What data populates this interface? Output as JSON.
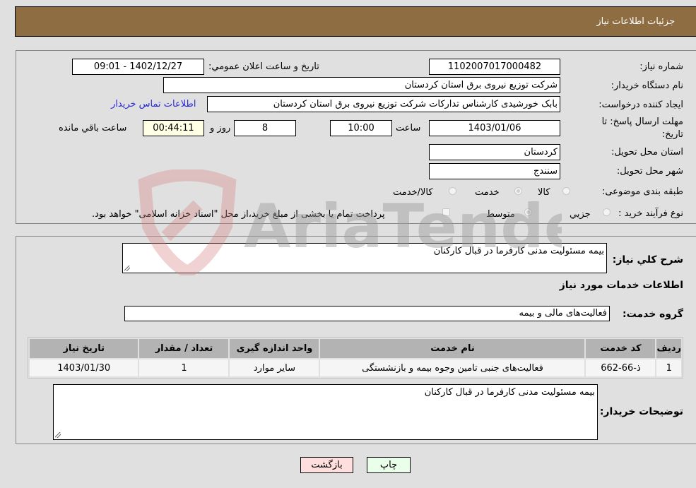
{
  "header": {
    "title": "جزئیات اطلاعات نیاز"
  },
  "form": {
    "need_number_label": "شماره نیاز:",
    "need_number": "1102007017000482",
    "announce_label": "تاریخ و ساعت اعلان عمومي:",
    "announce_value": "1402/12/27 - 09:01",
    "buyer_org_label": "نام دستگاه خریدار:",
    "buyer_org": "شرکت توزیع نیروی برق استان کردستان",
    "creator_label": "ایجاد کننده درخواست:",
    "creator": "بابک خورشیدی کارشناس تدارکات شرکت توزیع نیروی برق استان کردستان",
    "contact_link": "اطلاعات تماس خریدار",
    "deadline_label_line1": "مهلت ارسال پاسخ: تا",
    "deadline_label_line2": "تاریخ:",
    "deadline_date": "1403/01/06",
    "time_label": "ساعت",
    "deadline_time": "10:00",
    "days_value": "8",
    "days_label": "روز و",
    "remaining_time": "00:44:11",
    "remaining_label": "ساعت باقي مانده",
    "province_label": "استان محل تحویل:",
    "province": "کردستان",
    "city_label": "شهر محل تحویل:",
    "city": "سنندج",
    "category_label": "طبقه بندی موضوعی:",
    "category_options": [
      {
        "label": "کالا",
        "checked": false
      },
      {
        "label": "خدمت",
        "checked": true
      },
      {
        "label": "کالا/خدمت",
        "checked": false
      }
    ],
    "process_label": "نوع فرآیند خرید :",
    "process_options": [
      {
        "label": "جزيي",
        "checked": false
      },
      {
        "label": "متوسط",
        "checked": true
      }
    ],
    "treasury_note": "پرداخت تمام یا بخشی از مبلغ خرید،از محل \"اسناد خزانه اسلامی\" خواهد بود.",
    "treasury_checked": false
  },
  "details": {
    "summary_label": "شرح کلي نیاز:",
    "summary": "بیمه مسئولیت مدنی کارفرما در قبال کارکنان",
    "services_heading": "اطلاعات خدمات مورد نیاز",
    "service_group_label": "گروه خدمت:",
    "service_group": "فعالیت‌های مالی و بیمه",
    "table": {
      "headers": [
        "ردیف",
        "کد خدمت",
        "نام خدمت",
        "واحد اندازه گیری",
        "تعداد / مقدار",
        "تاریخ نیاز"
      ],
      "rows": [
        [
          "1",
          "ذ-66-662",
          "فعالیت‌های جنبی تامین وجوه بیمه و بازنشستگی",
          "سایر موارد",
          "1",
          "1403/01/30"
        ]
      ]
    },
    "buyer_notes_label": "توضیحات خریدار:",
    "buyer_notes": "بیمه مسئولیت مدنی کارفرما در قبال کارکنان"
  },
  "buttons": {
    "print": "چاپ",
    "back": "بازگشت"
  },
  "watermark": {
    "text": "AriaTender.neT"
  },
  "colors": {
    "header_bg": "#8e6d42",
    "link": "#2a2ad8",
    "back_btn": "#ffdede",
    "print_btn": "#eaffea"
  }
}
